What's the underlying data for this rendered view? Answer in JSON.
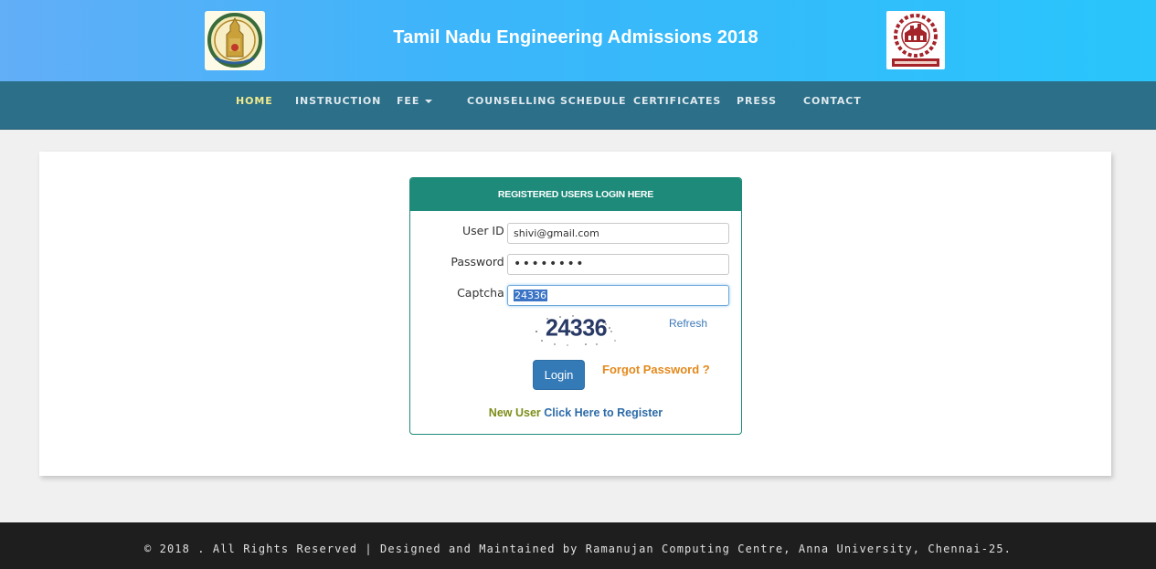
{
  "header": {
    "title": "Tamil Nadu Engineering Admissions 2018",
    "left_logo": "tn-government-emblem",
    "right_logo": "anna-university-logo"
  },
  "nav": {
    "items": [
      {
        "label": "HOME",
        "active": true
      },
      {
        "label": "INSTRUCTION",
        "active": false
      },
      {
        "label": "FEE",
        "active": false,
        "dropdown": true
      },
      {
        "label": "COUNSELLING SCHEDULE",
        "active": false
      },
      {
        "label": "CERTIFICATES",
        "active": false
      },
      {
        "label": "PRESS",
        "active": false
      },
      {
        "label": "CONTACT",
        "active": false
      }
    ]
  },
  "login": {
    "panel_title": "REGISTERED USERS LOGIN HERE",
    "required_mark": "*",
    "user_id_label": "User ID",
    "user_id_value": "shivi@gmail.com",
    "password_label": "Password",
    "password_value": "••••••••",
    "captcha_label": "Captcha",
    "captcha_value": "24336",
    "captcha_image_text": "24336",
    "refresh_label": "Refresh",
    "login_button": "Login",
    "forgot_password": "Forgot Password ?",
    "new_user_text": "New User",
    "register_link": "Click Here to Register"
  },
  "footer": {
    "text": "© 2018 . All Rights Reserved | Designed and Maintained by Ramanujan Computing Centre, Anna University, Chennai-25."
  },
  "colors": {
    "header_gradient_start": "#62aef7",
    "header_gradient_end": "#29c5fb",
    "navbar": "#2b6f89",
    "nav_active": "#f3ea8c",
    "panel_teal": "#1d8a7a",
    "primary_button": "#337ab7",
    "forgot_orange": "#e4891c",
    "footer_bg": "#1e1e1e"
  }
}
